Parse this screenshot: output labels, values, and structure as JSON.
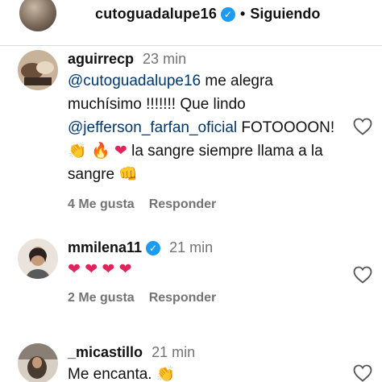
{
  "header": {
    "username": "cutoguadalupe16",
    "separator": "•",
    "follow_state": "Siguiendo"
  },
  "comments": [
    {
      "username": "aguirrecp",
      "time": "23 min",
      "segments": [
        {
          "type": "mention",
          "text": "@cutoguadalupe16"
        },
        {
          "type": "text",
          "text": " me alegra muchísimo !!!!!!! Que lindo "
        },
        {
          "type": "mention",
          "text": "@jefferson_farfan_oficial"
        },
        {
          "type": "text",
          "text": " FOTOOOON! "
        }
      ],
      "emojis_1": [
        "👏",
        "🔥",
        "❤"
      ],
      "text_2": " la sangre siempre llama a la sangre ",
      "emoji_2": "👊",
      "likes": "4 Me gusta",
      "reply": "Responder"
    },
    {
      "username": "mmilena11",
      "verified": true,
      "time": "21 min",
      "hearts": [
        "❤",
        "❤",
        "❤",
        "❤"
      ],
      "likes": "2 Me gusta",
      "reply": "Responder"
    },
    {
      "username": "_micastillo",
      "time": "21 min",
      "text": "Me encanta. ",
      "emoji": "👏"
    }
  ],
  "icons": {
    "like": "heart-outline-icon",
    "verified": "verified-badge-icon"
  },
  "colors": {
    "link": "#00376b",
    "muted": "#737373",
    "verified": "#1d9bf0",
    "heart": "#e0245e"
  }
}
